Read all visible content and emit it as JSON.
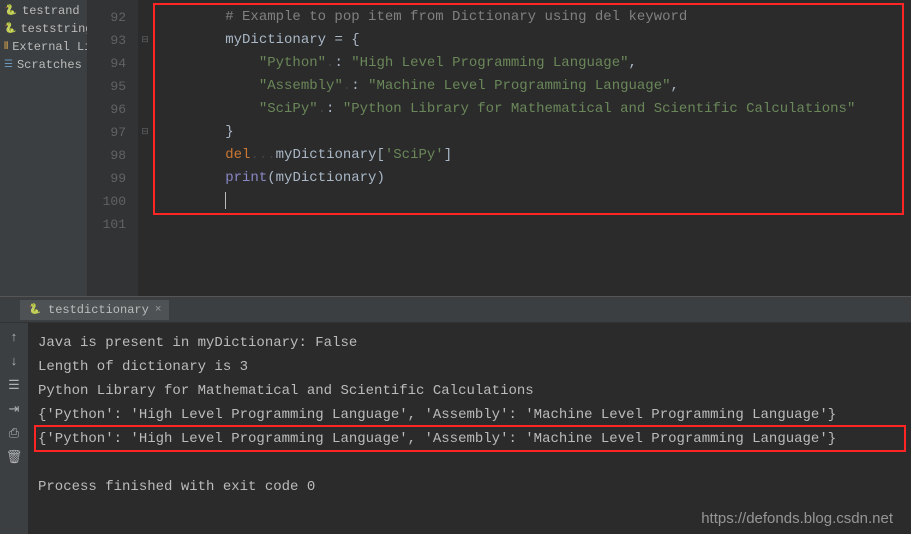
{
  "project": {
    "items": [
      {
        "icon": "py",
        "label": "testrand"
      },
      {
        "icon": "py",
        "label": "teststring"
      },
      {
        "icon": "lib",
        "label": "External Lib"
      },
      {
        "icon": "scratch",
        "label": "Scratches a"
      }
    ]
  },
  "editor": {
    "lines": [
      {
        "num": "92",
        "fold": "",
        "indent": "        ",
        "tokens": [
          {
            "cls": "c-comment",
            "t": "# Example to pop item from Dictionary using del keyword"
          }
        ]
      },
      {
        "num": "93",
        "fold": "⊟",
        "indent": "        ",
        "tokens": [
          {
            "cls": "c-ident",
            "t": "myDictionary "
          },
          {
            "cls": "c-punct",
            "t": "= {"
          }
        ]
      },
      {
        "num": "94",
        "fold": "",
        "indent": "            ",
        "tokens": [
          {
            "cls": "c-str",
            "t": "\"Python\""
          },
          {
            "cls": "c-whitespace-dot",
            "t": "."
          },
          {
            "cls": "c-punct",
            "t": ": "
          },
          {
            "cls": "c-str",
            "t": "\"High Level Programming Language\""
          },
          {
            "cls": "c-punct",
            "t": ","
          }
        ]
      },
      {
        "num": "95",
        "fold": "",
        "indent": "            ",
        "tokens": [
          {
            "cls": "c-str",
            "t": "\"Assembly\""
          },
          {
            "cls": "c-whitespace-dot",
            "t": "."
          },
          {
            "cls": "c-punct",
            "t": ": "
          },
          {
            "cls": "c-str",
            "t": "\"Machine Level Programming Language\""
          },
          {
            "cls": "c-punct",
            "t": ","
          }
        ]
      },
      {
        "num": "96",
        "fold": "",
        "indent": "            ",
        "tokens": [
          {
            "cls": "c-str",
            "t": "\"SciPy\""
          },
          {
            "cls": "c-whitespace-dot",
            "t": "."
          },
          {
            "cls": "c-punct",
            "t": ": "
          },
          {
            "cls": "c-str",
            "t": "\"Python Library for Mathematical and Scientific Calculations\""
          }
        ]
      },
      {
        "num": "97",
        "fold": "⊟",
        "indent": "        ",
        "tokens": [
          {
            "cls": "c-punct",
            "t": "}"
          }
        ]
      },
      {
        "num": "98",
        "fold": "",
        "indent": "        ",
        "tokens": [
          {
            "cls": "c-keyword",
            "t": "del"
          },
          {
            "cls": "c-whitespace-dot",
            "t": "..."
          },
          {
            "cls": "c-ident",
            "t": "myDictionary["
          },
          {
            "cls": "c-str",
            "t": "'SciPy'"
          },
          {
            "cls": "c-ident",
            "t": "]"
          }
        ]
      },
      {
        "num": "99",
        "fold": "",
        "indent": "        ",
        "tokens": [
          {
            "cls": "c-builtin",
            "t": "print"
          },
          {
            "cls": "c-punct",
            "t": "(myDictionary)"
          }
        ]
      },
      {
        "num": "100",
        "fold": "",
        "indent": "        ",
        "tokens": [
          {
            "cls": "caret",
            "t": ""
          }
        ]
      },
      {
        "num": "101",
        "fold": "",
        "indent": "",
        "tokens": []
      }
    ]
  },
  "run": {
    "tab_label": "testdictionary",
    "tool_icons": [
      "↑",
      "↓",
      "☰",
      "⇥",
      "⎙",
      "🗑"
    ],
    "output": [
      "Java is present in myDictionary: False",
      "Length of dictionary is 3",
      "Python Library for Mathematical and Scientific Calculations",
      "{'Python': 'High Level Programming Language', 'Assembly': 'Machine Level Programming Language'}",
      "{'Python': 'High Level Programming Language', 'Assembly': 'Machine Level Programming Language'}",
      "",
      "Process finished with exit code 0"
    ]
  },
  "watermark": "https://defonds.blog.csdn.net"
}
